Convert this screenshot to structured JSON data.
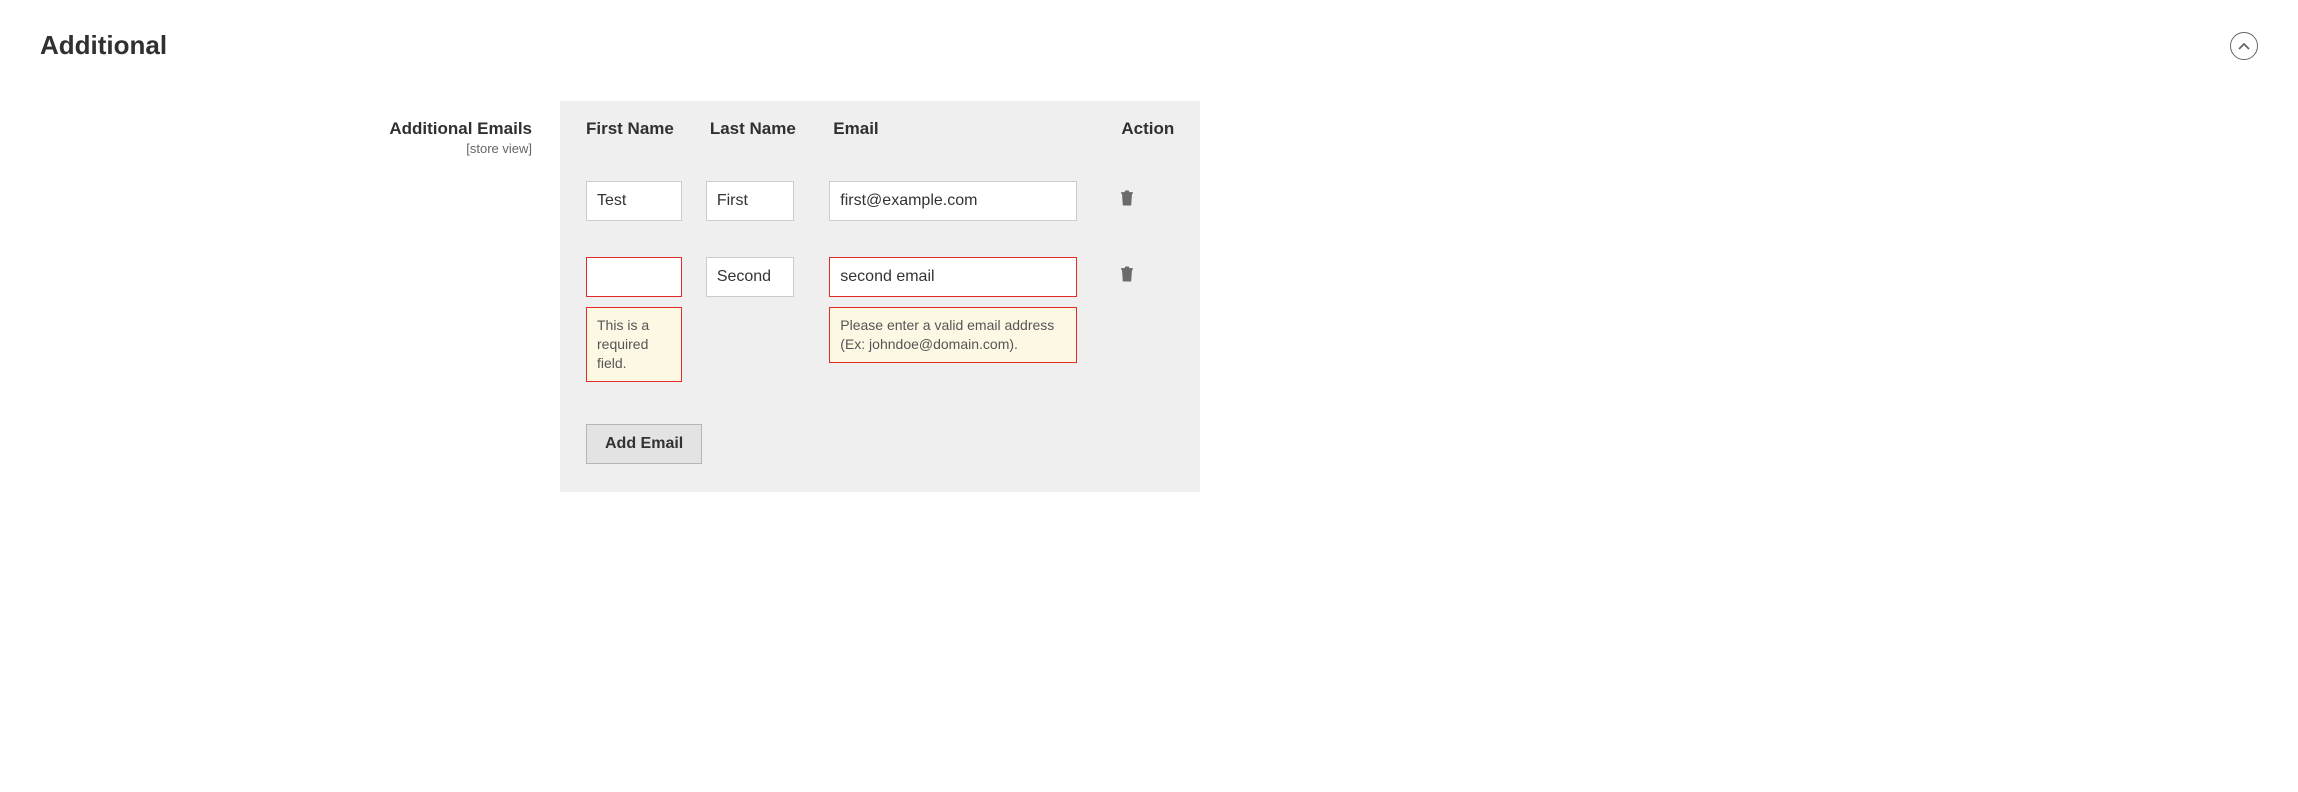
{
  "section": {
    "title": "Additional"
  },
  "field": {
    "label": "Additional Emails",
    "scope": "[store view]"
  },
  "columns": {
    "first_name": "First Name",
    "last_name": "Last Name",
    "email": "Email",
    "action": "Action"
  },
  "rows": [
    {
      "first_name": "Test",
      "last_name": "First",
      "email": "first@example.com",
      "first_name_error": "",
      "email_error": ""
    },
    {
      "first_name": "",
      "last_name": "Second",
      "email": "second email",
      "first_name_error": "This is a required field.",
      "email_error": "Please enter a valid email address (Ex: johndoe@domain.com)."
    }
  ],
  "buttons": {
    "add": "Add Email"
  }
}
